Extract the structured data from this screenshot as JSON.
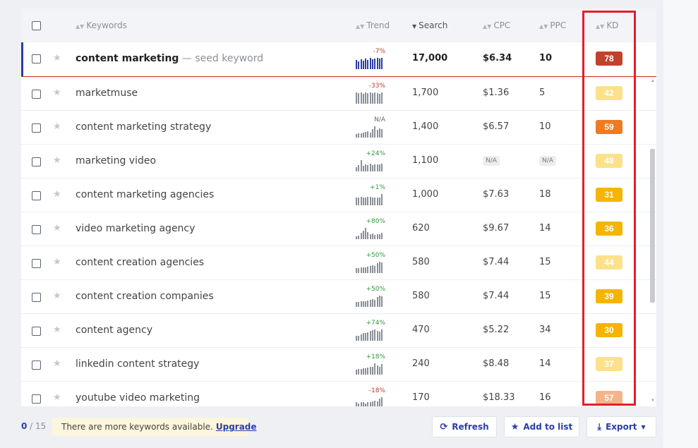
{
  "header": {
    "keywords": "Keywords",
    "trend": "Trend",
    "search": "Search",
    "cpc": "CPC",
    "ppc": "PPC",
    "kd": "KD"
  },
  "seed": {
    "keyword": "content marketing",
    "suffix": " — seed keyword",
    "trend": "-7%",
    "trend_dir": "neg",
    "spark": [
      12,
      10,
      13,
      11,
      14,
      12,
      15,
      13,
      14,
      15,
      14,
      15
    ],
    "search": "17,000",
    "cpc": "$6.34",
    "ppc": "10",
    "kd": "78",
    "kd_color": "#c0422c"
  },
  "rows": [
    {
      "keyword": "marketmuse",
      "trend": "-33%",
      "trend_dir": "neg",
      "spark": [
        15,
        14,
        15,
        13,
        15,
        14,
        15,
        14,
        15,
        14,
        13,
        15
      ],
      "search": "1,700",
      "cpc": "$1.36",
      "ppc": "5",
      "kd": "42",
      "kd_color": "#fbe28a"
    },
    {
      "keyword": "content marketing strategy",
      "trend": "N/A",
      "trend_dir": "na",
      "spark": [
        5,
        6,
        6,
        7,
        8,
        9,
        7,
        12,
        16,
        11,
        13,
        12
      ],
      "search": "1,400",
      "cpc": "$6.57",
      "ppc": "10",
      "kd": "59",
      "kd_color": "#ee7a24"
    },
    {
      "keyword": "marketing video",
      "trend": "+24%",
      "trend_dir": "pos",
      "spark": [
        6,
        9,
        16,
        8,
        10,
        9,
        11,
        9,
        10,
        10,
        10,
        11
      ],
      "search": "1,100",
      "cpc": "N/A",
      "ppc": "N/A",
      "kd": "48",
      "kd_color": "#fbe28a"
    },
    {
      "keyword": "content marketing agencies",
      "trend": "+1%",
      "trend_dir": "pos",
      "spark": [
        10,
        10,
        11,
        10,
        10,
        11,
        11,
        10,
        10,
        10,
        10,
        15
      ],
      "search": "1,000",
      "cpc": "$7.63",
      "ppc": "18",
      "kd": "31",
      "kd_color": "#f5b400"
    },
    {
      "keyword": "video marketing agency",
      "trend": "+80%",
      "trend_dir": "pos",
      "spark": [
        4,
        5,
        9,
        12,
        16,
        10,
        7,
        8,
        6,
        7,
        7,
        9
      ],
      "search": "620",
      "cpc": "$9.67",
      "ppc": "14",
      "kd": "36",
      "kd_color": "#f5b400"
    },
    {
      "keyword": "content creation agencies",
      "trend": "+50%",
      "trend_dir": "pos",
      "spark": [
        6,
        6,
        7,
        7,
        7,
        8,
        9,
        10,
        9,
        12,
        14,
        13
      ],
      "search": "580",
      "cpc": "$7.44",
      "ppc": "15",
      "kd": "44",
      "kd_color": "#fbe28a"
    },
    {
      "keyword": "content creation companies",
      "trend": "+50%",
      "trend_dir": "pos",
      "spark": [
        6,
        6,
        7,
        7,
        7,
        8,
        9,
        10,
        9,
        12,
        14,
        13
      ],
      "search": "580",
      "cpc": "$7.44",
      "ppc": "15",
      "kd": "39",
      "kd_color": "#f5b400"
    },
    {
      "keyword": "content agency",
      "trend": "+74%",
      "trend_dir": "pos",
      "spark": [
        7,
        7,
        8,
        10,
        10,
        11,
        13,
        14,
        15,
        13,
        12,
        15
      ],
      "search": "470",
      "cpc": "$5.22",
      "ppc": "34",
      "kd": "30",
      "kd_color": "#f5b400"
    },
    {
      "keyword": "linkedin content strategy",
      "trend": "+18%",
      "trend_dir": "pos",
      "spark": [
        6,
        7,
        7,
        8,
        8,
        9,
        10,
        10,
        14,
        11,
        10,
        13
      ],
      "search": "240",
      "cpc": "$8.48",
      "ppc": "14",
      "kd": "37",
      "kd_color": "#fbe28a"
    },
    {
      "keyword": "youtube video marketing",
      "trend": "-18%",
      "trend_dir": "neg",
      "spark": [
        7,
        6,
        7,
        7,
        6,
        7,
        7,
        8,
        9,
        8,
        11,
        13
      ],
      "search": "170",
      "cpc": "$18.33",
      "ppc": "16",
      "kd": "57",
      "kd_color": "#f4b488"
    }
  ],
  "footer": {
    "selected": "0",
    "total": " / 15",
    "notice": "There are more keywords available.",
    "upgrade": "Upgrade",
    "refresh": "Refresh",
    "add_to_list": "Add to list",
    "export": "Export"
  }
}
